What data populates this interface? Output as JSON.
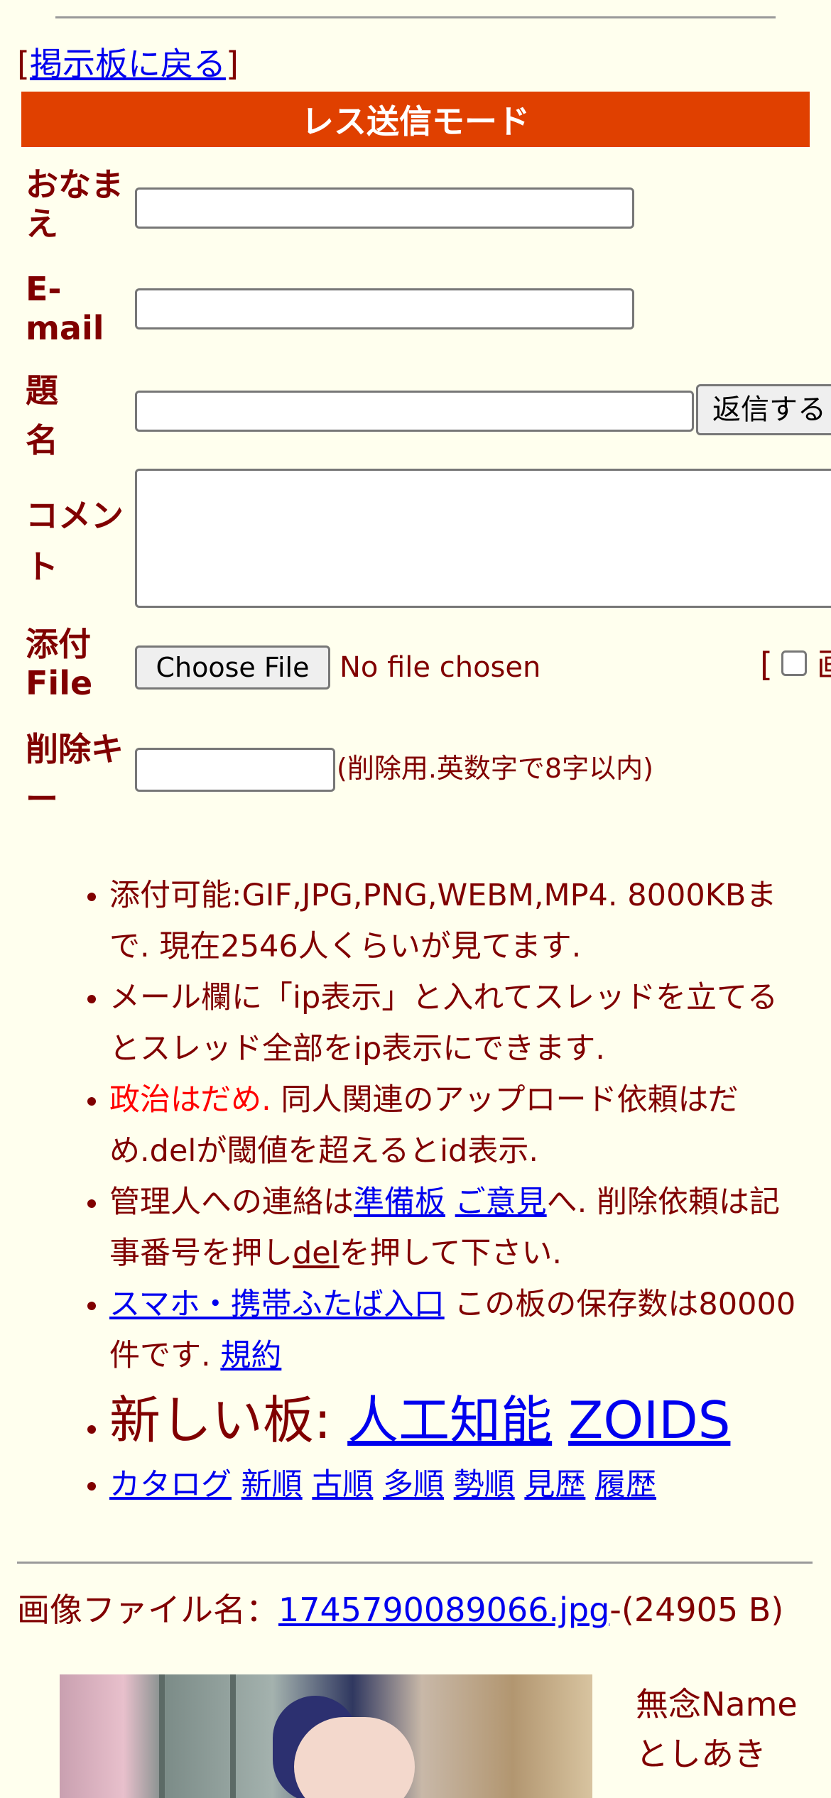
{
  "nav": {
    "back_bracket_open": "[",
    "back_label": "掲示板に戻る",
    "back_bracket_close": "]"
  },
  "form": {
    "mode_title": "レス送信モード",
    "name_label_1": "おなま",
    "name_label_2": "え",
    "email_label_1": "E-",
    "email_label_2": "mail",
    "subject_label_1": "題",
    "subject_label_2": "名",
    "submit_label": "返信する",
    "comment_label_1": "コメン",
    "comment_label_2": "ト",
    "attach_label_1": "添付",
    "attach_label_2": "File",
    "choose_file": "Choose File",
    "no_file": "No file chosen",
    "bracket": "[",
    "image_only_label": "画",
    "delkey_label_1": "削除キ",
    "delkey_label_2": "ー",
    "delkey_note": "(削除用.英数字で8字以内)"
  },
  "notes": {
    "n1": "添付可能:GIF,JPG,PNG,WEBM,MP4. 8000KBまで. 現在2546人くらいが見てます.",
    "n2": "メール欄に「ip表示」と入れてスレッドを立てるとスレッド全部をip表示にできます.",
    "n3_red": "政治はだめ.",
    "n3_rest": " 同人関連のアップロード依頼はだめ.delが閾値を超えるとid表示.",
    "n4_a": "管理人への連絡は",
    "n4_link1": "準備板",
    "n4_link2": "ご意見",
    "n4_b": "へ. 削除依頼は記事番号を押し",
    "n4_link3": "del",
    "n4_c": "を押して下さい.",
    "n5_link": "スマホ・携帯ふたば入口",
    "n5_a": " この板の保存数は80000件です. ",
    "n5_link2": "規約",
    "n6_a": "新しい板: ",
    "n6_link1": "人工知能",
    "n6_link2": "ZOIDS",
    "links": [
      "カタログ",
      "新順",
      "古順",
      "多順",
      "勢順",
      "見歴",
      "履歴"
    ]
  },
  "post": {
    "file_prefix": "画像ファイル名：",
    "file_name": "1745790089066.jpg",
    "file_size": "-(24905 B)",
    "name": "無念Name",
    "poster": "としあき"
  }
}
